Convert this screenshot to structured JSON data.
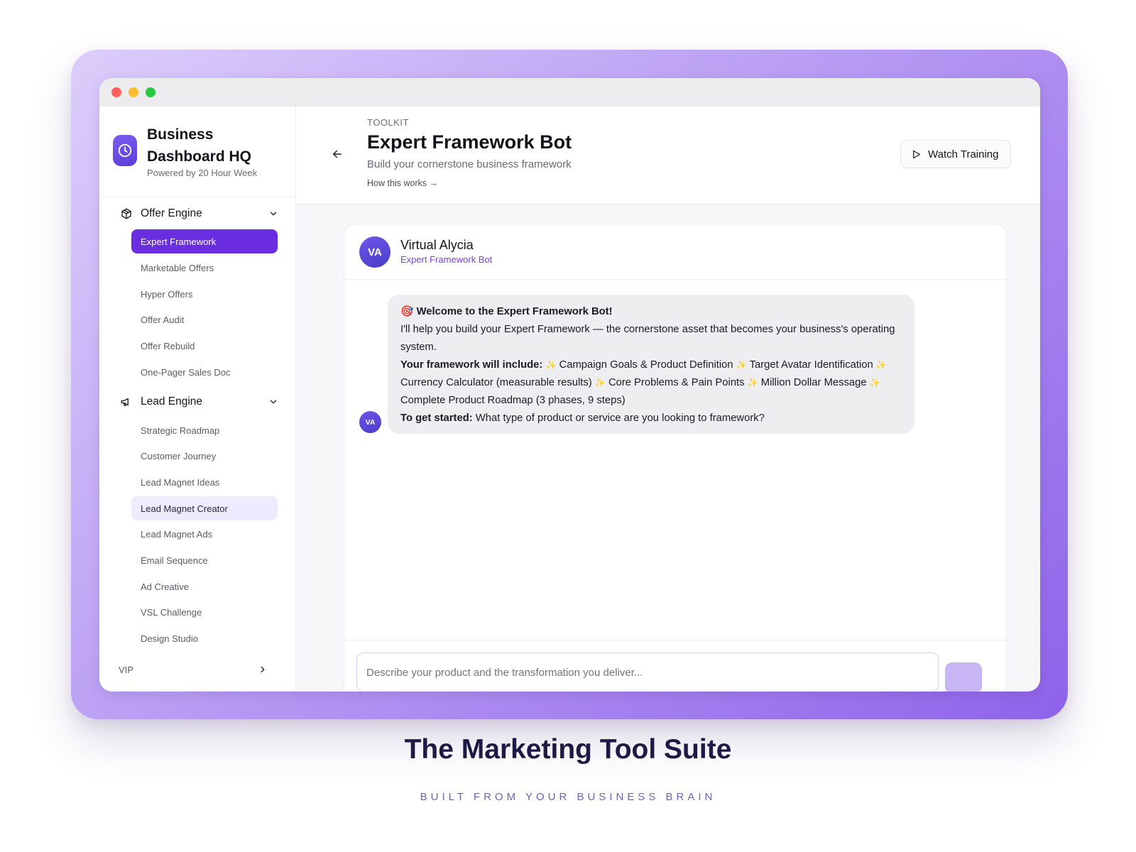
{
  "window": {
    "controls": [
      "close",
      "minimize",
      "maximize"
    ]
  },
  "sidebar": {
    "brand": {
      "title": "Business Dashboard HQ",
      "subtitle": "Powered by 20 Hour Week",
      "icon": "clock-icon"
    },
    "sections": [
      {
        "label": "Offer Engine",
        "icon": "box-icon",
        "expanded": true,
        "items": [
          {
            "label": "Expert Framework",
            "state": "active"
          },
          {
            "label": "Marketable Offers",
            "state": "default"
          },
          {
            "label": "Hyper Offers",
            "state": "default"
          },
          {
            "label": "Offer Audit",
            "state": "default"
          },
          {
            "label": "Offer Rebuild",
            "state": "default"
          },
          {
            "label": "One-Pager Sales Doc",
            "state": "default"
          }
        ]
      },
      {
        "label": "Lead Engine",
        "icon": "megaphone-icon",
        "expanded": true,
        "items": [
          {
            "label": "Strategic Roadmap",
            "state": "default"
          },
          {
            "label": "Customer Journey",
            "state": "default"
          },
          {
            "label": "Lead Magnet Ideas",
            "state": "default"
          },
          {
            "label": "Lead Magnet Creator",
            "state": "hover"
          },
          {
            "label": "Lead Magnet Ads",
            "state": "default"
          },
          {
            "label": "Email Sequence",
            "state": "default"
          },
          {
            "label": "Ad Creative",
            "state": "default"
          },
          {
            "label": "VSL Challenge",
            "state": "default"
          },
          {
            "label": "Design Studio",
            "state": "default"
          }
        ]
      }
    ],
    "vip": {
      "label": "VIP"
    }
  },
  "header": {
    "eyebrow": "TOOLKIT",
    "title": "Expert Framework Bot",
    "subtitle": "Build your cornerstone business framework",
    "how_link": "How this works →",
    "watch_button": "Watch Training"
  },
  "chat": {
    "bot_initials": "VA",
    "bot_name": "Virtual Alycia",
    "bot_role": "Expert Framework Bot",
    "message": {
      "emoji": "🎯",
      "heading": "Welcome to the Expert Framework Bot!",
      "intro": "I'll help you build your Expert Framework — the cornerstone asset that becomes your business's operating system.",
      "include_label": "Your framework will include:",
      "include_items": [
        "Campaign Goals & Product Definition",
        "Target Avatar Identification",
        "Currency Calculator (measurable results)",
        "Core Problems & Pain Points",
        "Million Dollar Message",
        "Complete Product Roadmap (3 phases, 9 steps)"
      ],
      "start_label": "To get started:",
      "start_question": "What type of product or service are you looking to framework?"
    },
    "input_placeholder": "Describe your product and the transformation you deliver..."
  },
  "caption": {
    "title": "The Marketing Tool Suite",
    "subtitle": "BUILT FROM YOUR BUSINESS BRAIN"
  },
  "colors": {
    "accent": "#6a2ee0",
    "accent_light": "#efeafd",
    "frame_gradient_start": "#dccdfb",
    "frame_gradient_end": "#8f63ea",
    "bot_role": "#7a3fe6",
    "caption_title": "#1d1a45"
  }
}
